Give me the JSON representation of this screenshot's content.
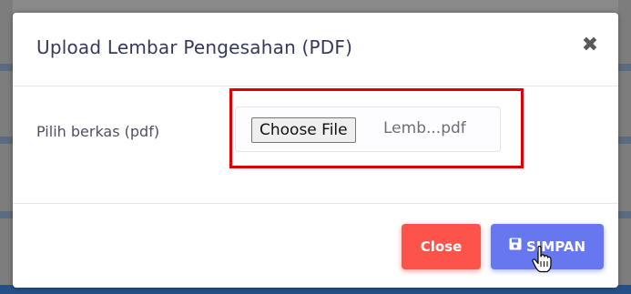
{
  "modal": {
    "title": "Upload Lembar Pengesahan (PDF)",
    "close_symbol": "✖",
    "field_label": "Pilih berkas (pdf)",
    "file_input": {
      "button_label": "Choose File",
      "file_name": "Lemb...pdf"
    },
    "footer": {
      "close_label": "Close",
      "save_label": "SIMPAN",
      "save_icon": "floppy-disk-icon"
    }
  },
  "colors": {
    "close_button": "#fc544b",
    "save_button": "#6777ef",
    "highlight": "#e10000",
    "title_text": "#34395e"
  },
  "icons": {
    "close": "close-icon",
    "save": "floppy-disk-icon",
    "cursor": "hand-pointer-icon"
  }
}
